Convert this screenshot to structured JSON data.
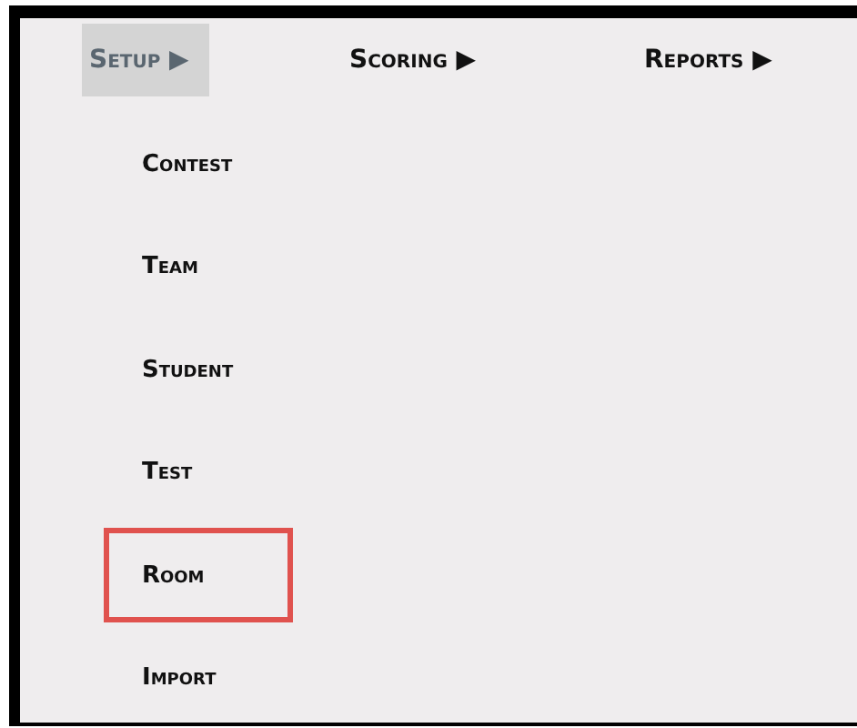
{
  "menu": [
    {
      "label": "Setup",
      "arrow": "▶",
      "selected": true
    },
    {
      "label": "Scoring",
      "arrow": "▶",
      "selected": false
    },
    {
      "label": "Reports",
      "arrow": "▶",
      "selected": false
    }
  ],
  "submenu": [
    {
      "label": "Contest",
      "outlined": false
    },
    {
      "label": "Team",
      "outlined": false
    },
    {
      "label": "Student",
      "outlined": false
    },
    {
      "label": "Test",
      "outlined": false
    },
    {
      "label": "Room",
      "outlined": true
    },
    {
      "label": "Import",
      "outlined": false
    }
  ]
}
